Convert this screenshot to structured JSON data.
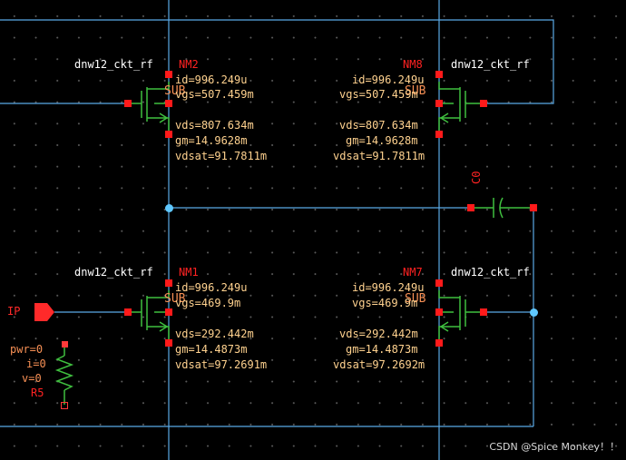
{
  "colors": {
    "wire": "#5aa9e6",
    "device": "#3fbf3f",
    "pin": "#ff1a1a",
    "node": "#5fc8ff",
    "label_red": "#ff2222",
    "label_orange": "#f79055",
    "model_label": "#ffffff"
  },
  "devices": {
    "nm2": {
      "name": "NM2",
      "model": "dnw12_ckt_rf",
      "sub": "SUB",
      "id": "id=996.249u",
      "vgs": "vgs=507.459m",
      "vds": "vds=807.634m",
      "gm": "gm=14.9628m",
      "vdsat": "vdsat=91.7811m"
    },
    "nm8": {
      "name": "NM8",
      "model": "dnw12_ckt_rf",
      "sub": "SUB",
      "id": "id=996.249u",
      "vgs": "vgs=507.459m",
      "vds": "vds=807.634m",
      "gm": "gm=14.9628m",
      "vdsat": "vdsat=91.7811m"
    },
    "nm1": {
      "name": "NM1",
      "model": "dnw12_ckt_rf",
      "sub": "SUB",
      "id": "id=996.249u",
      "vgs": "vgs=469.9m",
      "vds": "vds=292.442m",
      "gm": "gm=14.4873m",
      "vdsat": "vdsat=97.2691m"
    },
    "nm7": {
      "name": "NM7",
      "model": "dnw12_ckt_rf",
      "sub": "SUB",
      "id": "id=996.249u",
      "vgs": "vgs=469.9m",
      "vds": "vds=292.442m",
      "gm": "gm=14.4873m",
      "vdsat": "vdsat=97.2692m"
    }
  },
  "capacitor": {
    "name": "C0"
  },
  "port": {
    "name": "IP",
    "pwr": "pwr=0",
    "i": "i=0",
    "v": "v=0",
    "ref": "R5"
  },
  "watermark": "CSDN @Spice Monkey！！"
}
